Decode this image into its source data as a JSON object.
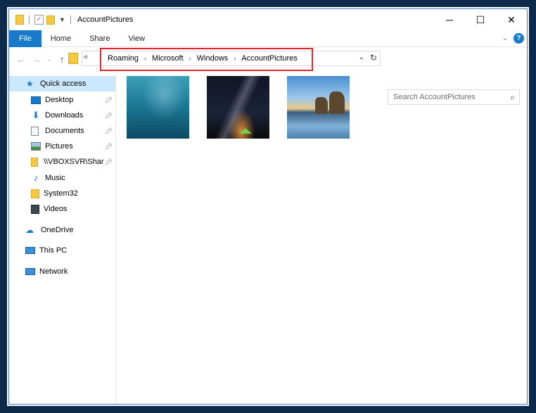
{
  "window": {
    "title": "AccountPictures",
    "controls": {
      "minimize": "─",
      "maximize": "☐",
      "close": "✕"
    }
  },
  "ribbon": {
    "tabs": [
      "File",
      "Home",
      "Share",
      "View"
    ],
    "expand_icon": "chevron-down-icon",
    "help_label": "?"
  },
  "address": {
    "breadcrumb": [
      "Roaming",
      "Microsoft",
      "Windows",
      "AccountPictures"
    ],
    "first_separator": "«",
    "separator": "›"
  },
  "search": {
    "placeholder": "Search AccountPictures"
  },
  "nav": {
    "items": [
      {
        "label": "Quick access",
        "icon": "star-icon",
        "selected": true
      },
      {
        "label": "Desktop",
        "icon": "desktop-icon",
        "pinned": true
      },
      {
        "label": "Downloads",
        "icon": "download-icon",
        "pinned": true
      },
      {
        "label": "Documents",
        "icon": "documents-icon",
        "pinned": true
      },
      {
        "label": "Pictures",
        "icon": "pictures-icon",
        "pinned": true
      },
      {
        "label": "\\\\VBOXSVR\\Shar",
        "icon": "network-share-icon",
        "pinned": true
      },
      {
        "label": "Music",
        "icon": "music-icon"
      },
      {
        "label": "System32",
        "icon": "folder-icon"
      },
      {
        "label": "Videos",
        "icon": "videos-icon"
      },
      {
        "label": "OneDrive",
        "icon": "cloud-icon"
      },
      {
        "label": "This PC",
        "icon": "computer-icon"
      },
      {
        "label": "Network",
        "icon": "network-icon"
      }
    ]
  },
  "content": {
    "thumbnails": [
      "underwater-photo",
      "night-sky-photo",
      "beach-rocks-photo"
    ]
  },
  "colors": {
    "accent": "#1979ca",
    "highlight_box": "#e0282c",
    "selected_bg": "#cce8ff"
  }
}
